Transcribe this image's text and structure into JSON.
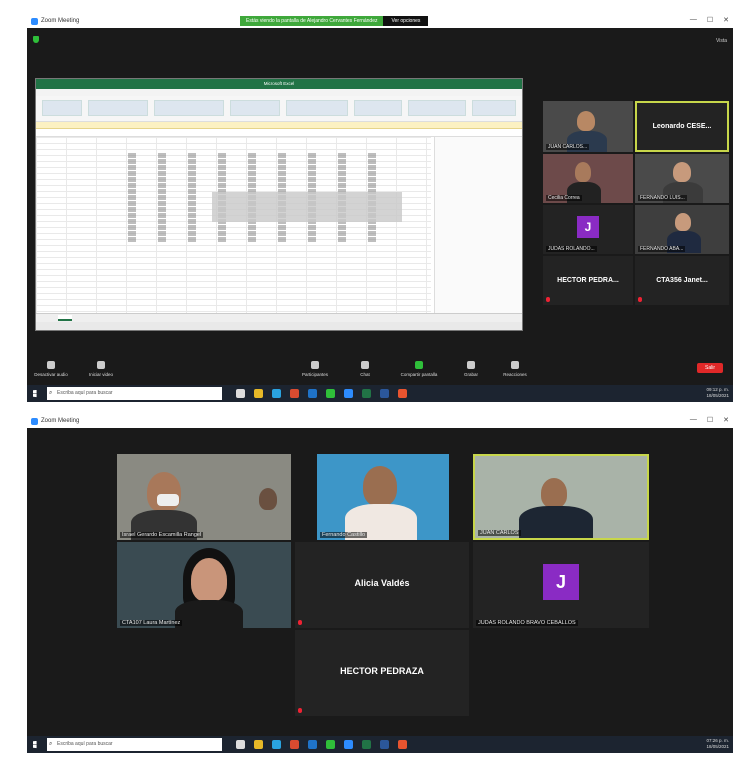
{
  "shot1": {
    "window_title": "Zoom Meeting",
    "banner_text": "Estás viendo la pantalla de Alejandro Cervantes Fernández",
    "view_options": "Ver opciones",
    "view_label": "Vista",
    "excel_title": "Microsoft Excel",
    "search_placeholder": "Escriba aquí para buscar",
    "participants": [
      {
        "name": "JUAN CARLOS...",
        "kind": "video"
      },
      {
        "name": "Leonardo CESE...",
        "kind": "name",
        "active": true
      },
      {
        "name": "Cecilia Correa",
        "kind": "video"
      },
      {
        "name": "FERNANDO LUIS...",
        "kind": "video"
      },
      {
        "name": "J",
        "caption": "JUDAS ROLANDO...",
        "kind": "avatar"
      },
      {
        "name": "FERNANDO ABA...",
        "kind": "video"
      },
      {
        "name": "HECTOR PEDRA...",
        "kind": "name"
      },
      {
        "name": "CTA356 Janet...",
        "kind": "name"
      }
    ],
    "controls": {
      "mute": "Desactivar audio",
      "video": "Iniciar video",
      "participants": "Participantes",
      "participants_count": "11",
      "chat": "Chat",
      "share": "Compartir pantalla",
      "record": "Grabar",
      "reactions": "Reacciones",
      "end": "Salir"
    },
    "clock": {
      "time": "09:12 p. m.",
      "date": "18/05/2021"
    }
  },
  "shot2": {
    "window_title": "Zoom Meeting",
    "search_placeholder": "Escriba aquí para buscar",
    "participants": [
      {
        "name": "Israel Gerardo Escamilla Rangel",
        "kind": "video"
      },
      {
        "name": "Fernando Castillo",
        "kind": "video"
      },
      {
        "name": "JUAN CARLOS",
        "kind": "video",
        "active": true
      },
      {
        "name": "CTA107 Laura Martínez",
        "kind": "video"
      },
      {
        "name": "Alicia Valdés",
        "kind": "name"
      },
      {
        "name": "J",
        "caption": "JUDAS ROLANDO BRAVO CEBALLOS",
        "kind": "avatar"
      },
      {
        "name": "HECTOR PEDRAZA",
        "kind": "name"
      }
    ],
    "clock": {
      "time": "07:26 p. m.",
      "date": "18/05/2021"
    }
  },
  "colors": {
    "zoom_bg": "#1a1a1a",
    "active_border": "#c7d64a",
    "avatar": "#8a2bc4",
    "end_button": "#e02828",
    "excel_green": "#217346"
  }
}
